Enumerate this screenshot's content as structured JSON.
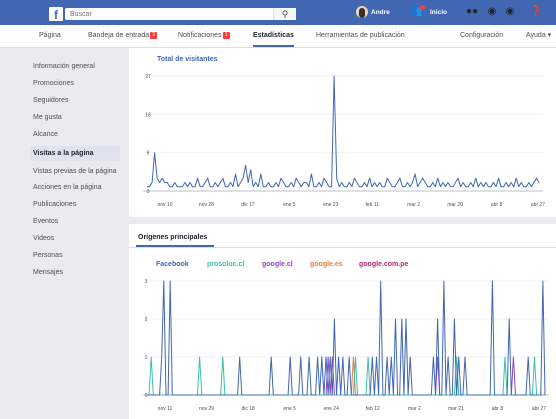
{
  "topbar": {
    "logo": "f",
    "search_placeholder": "Buscar",
    "search_icon": "search-icon",
    "user_name": "Andre",
    "home_label": "Inicio",
    "accent": "#4267b2"
  },
  "tabs": [
    {
      "label": "Página"
    },
    {
      "label": "Bandeja de entrada",
      "badge": "2"
    },
    {
      "label": "Notificaciones",
      "badge": "1"
    },
    {
      "label": "Estadísticas",
      "active": true
    },
    {
      "label": "Herramientas de publicación"
    },
    {
      "label": "Configuración"
    },
    {
      "label": "Ayuda ▾"
    }
  ],
  "sidebar": {
    "items": [
      {
        "label": "Información general"
      },
      {
        "label": "Promociones"
      },
      {
        "label": "Seguidores"
      },
      {
        "label": "Me gusta"
      },
      {
        "label": "Alcance"
      },
      {
        "label": "Visitas a la página",
        "active": true
      },
      {
        "label": "Vistas previas de la página"
      },
      {
        "label": "Acciones en la página"
      },
      {
        "label": "Publicaciones"
      },
      {
        "label": "Eventos"
      },
      {
        "label": "Videos"
      },
      {
        "label": "Personas"
      },
      {
        "label": "Mensajes"
      }
    ]
  },
  "chart_data": [
    {
      "type": "line",
      "title": "Total de visitantes",
      "ylim": [
        0,
        27
      ],
      "yticks": [
        "0",
        "9",
        "18",
        "27"
      ],
      "xticks": [
        "nov 10",
        "nov 28",
        "dic 17",
        "ene 5",
        "ene 23",
        "feb 11",
        "mar 2",
        "mar 20",
        "abr 8",
        "abr 27"
      ],
      "series": [
        {
          "color": "#4267b2",
          "values": [
            1,
            1,
            2,
            9,
            3,
            2,
            3,
            2,
            2,
            1,
            1,
            2,
            1,
            1,
            1,
            2,
            1,
            2,
            1,
            1,
            3,
            1,
            1,
            2,
            3,
            1,
            1,
            2,
            1,
            2,
            3,
            1,
            1,
            2,
            1,
            4,
            1,
            2,
            3,
            6,
            2,
            5,
            1,
            2,
            1,
            4,
            1,
            1,
            2,
            1,
            1,
            2,
            1,
            3,
            2,
            1,
            1,
            2,
            1,
            3,
            2,
            1,
            2,
            2,
            1,
            4,
            1,
            1,
            2,
            1,
            3,
            2,
            1,
            1,
            27,
            3,
            1,
            2,
            1,
            1,
            2,
            1,
            3,
            2,
            1,
            1,
            2,
            1,
            3,
            1,
            2,
            1,
            2,
            1,
            1,
            3,
            2,
            1,
            1,
            2,
            3,
            1,
            1,
            2,
            1,
            2,
            4,
            1,
            2,
            3,
            2,
            1,
            1,
            2,
            1,
            3,
            1,
            2,
            1,
            2,
            1,
            1,
            2,
            3,
            1,
            2,
            1,
            1,
            2,
            1,
            3,
            1,
            2,
            1,
            2,
            1,
            1,
            2,
            1,
            3,
            1,
            1,
            2,
            1,
            2,
            1,
            3,
            1,
            2,
            1,
            1,
            2,
            1,
            2,
            3,
            2
          ]
        }
      ]
    },
    {
      "type": "line",
      "title": "Orígenes principales",
      "ylim": [
        0,
        3
      ],
      "yticks": [
        "0",
        "1",
        "2",
        "3"
      ],
      "xticks": [
        "nov 11",
        "nov 29",
        "dic 18",
        "ene 5",
        "ene 24",
        "feb 12",
        "mar 2",
        "mar 21",
        "abr 8",
        "abr 27"
      ],
      "series": [
        {
          "name": "Facebook",
          "color": "#4267b2",
          "values": [
            0,
            0,
            0,
            0,
            0,
            0,
            0,
            1,
            3,
            0,
            0,
            3,
            0,
            0,
            0,
            0,
            0,
            0,
            0,
            0,
            0,
            0,
            0,
            0,
            0,
            0,
            0,
            0,
            0,
            0,
            0,
            0,
            0,
            0,
            0,
            0,
            0,
            0,
            0,
            0,
            0,
            0,
            0,
            0,
            1,
            0,
            0,
            0,
            0,
            0,
            0,
            0,
            0,
            0,
            0,
            0,
            0,
            0,
            0,
            1,
            0,
            0,
            0,
            0,
            0,
            0,
            0,
            0,
            1,
            0,
            0,
            0,
            0,
            1,
            0,
            0,
            0,
            1,
            0,
            0,
            0,
            1,
            0,
            1,
            0,
            1,
            0,
            1,
            0,
            2,
            0,
            1,
            0,
            1,
            0,
            0,
            1,
            0,
            0,
            0,
            0,
            0,
            0,
            0,
            0,
            0,
            0,
            1,
            0,
            1,
            0,
            3,
            0,
            0,
            1,
            0,
            1,
            0,
            2,
            0,
            0,
            2,
            0,
            2,
            0,
            1,
            0,
            0,
            0,
            0,
            0,
            0,
            0,
            0,
            0,
            0,
            1,
            0,
            2,
            0,
            0,
            3,
            0,
            1,
            0,
            0,
            2,
            0,
            1,
            0,
            0,
            1,
            0,
            0,
            0,
            0,
            0,
            0,
            0,
            0,
            0,
            0,
            0,
            0,
            3,
            0,
            0,
            0,
            0,
            0,
            0,
            0,
            2,
            0,
            0,
            0,
            0,
            0,
            0,
            0,
            0,
            1,
            0,
            0,
            0,
            0,
            0,
            0,
            3,
            0
          ]
        },
        {
          "name": "prosoluc.cl",
          "color": "#3bbfad",
          "values": [
            0,
            0,
            1,
            0,
            0,
            0,
            0,
            0,
            0,
            0,
            0,
            0,
            0,
            0,
            0,
            0,
            0,
            0,
            0,
            0,
            0,
            0,
            0,
            0,
            0,
            1,
            0,
            0,
            0,
            0,
            0,
            0,
            0,
            0,
            0,
            0,
            1,
            0,
            0,
            0,
            0,
            0,
            0,
            0,
            0,
            0,
            0,
            0,
            0,
            0,
            0,
            0,
            0,
            0,
            0,
            0,
            0,
            0,
            0,
            0,
            0,
            0,
            0,
            0,
            0,
            0,
            0,
            0,
            0,
            0,
            0,
            0,
            0,
            0,
            0,
            0,
            0,
            0,
            0,
            0,
            0,
            0,
            0,
            0,
            0,
            0,
            0,
            0,
            0,
            0,
            0,
            0,
            0,
            0,
            0,
            0,
            0,
            0,
            0,
            1,
            0,
            0,
            0,
            0,
            0,
            1,
            0,
            0,
            0,
            0,
            0,
            0,
            0,
            0,
            0,
            0,
            0,
            0,
            0,
            0,
            0,
            0,
            0,
            0,
            0,
            0,
            0,
            0,
            0,
            0,
            0,
            0,
            0,
            0,
            0,
            0,
            0,
            0,
            0,
            0,
            0,
            0,
            0,
            0,
            0,
            0,
            0,
            1,
            0,
            0,
            0,
            0,
            0,
            0,
            0,
            0,
            0,
            0,
            0,
            0,
            0,
            0,
            0,
            0,
            0,
            0,
            0,
            0,
            0,
            0,
            1,
            0,
            0,
            0,
            0,
            0,
            0,
            0,
            0,
            0,
            0,
            0,
            0,
            0,
            1,
            0,
            0,
            0,
            0,
            0
          ]
        },
        {
          "name": "google.cl",
          "color": "#8c45c4",
          "values": [
            0,
            0,
            0,
            0,
            0,
            0,
            0,
            0,
            0,
            0,
            0,
            0,
            0,
            0,
            0,
            0,
            0,
            0,
            0,
            0,
            0,
            0,
            0,
            0,
            0,
            0,
            0,
            0,
            0,
            0,
            0,
            0,
            0,
            0,
            0,
            0,
            0,
            0,
            0,
            0,
            0,
            0,
            0,
            0,
            0,
            0,
            0,
            0,
            0,
            0,
            0,
            0,
            0,
            0,
            0,
            0,
            0,
            0,
            0,
            0,
            0,
            0,
            0,
            0,
            0,
            0,
            0,
            0,
            0,
            0,
            0,
            0,
            0,
            0,
            0,
            0,
            0,
            0,
            0,
            0,
            0,
            0,
            0,
            0,
            0,
            0,
            1,
            0,
            1,
            0,
            0,
            0,
            0,
            0,
            0,
            0,
            0,
            0,
            0,
            0,
            0,
            0,
            0,
            0,
            0,
            0,
            0,
            0,
            0,
            0,
            0,
            0,
            0,
            0,
            0,
            0,
            0,
            0,
            0,
            0,
            0,
            0,
            0,
            0,
            0,
            0,
            0,
            0,
            0,
            0,
            0,
            0,
            0,
            0,
            0,
            0,
            0,
            0,
            1,
            0,
            0,
            0,
            0,
            0,
            0,
            0,
            0,
            0,
            0,
            0,
            0,
            0,
            0,
            0,
            0,
            0,
            0,
            0,
            0,
            0,
            0,
            0,
            0,
            0,
            0,
            0,
            0,
            0,
            0,
            0,
            0,
            0,
            0,
            0,
            1,
            0,
            0,
            0,
            0,
            0,
            0,
            0,
            0,
            0,
            0,
            0,
            0,
            0,
            0,
            0
          ]
        },
        {
          "name": "google.es",
          "color": "#f0783c",
          "values": [
            0,
            0,
            0,
            0,
            0,
            0,
            0,
            0,
            0,
            0,
            0,
            0,
            0,
            0,
            0,
            0,
            0,
            0,
            0,
            0,
            0,
            0,
            0,
            0,
            0,
            0,
            0,
            0,
            0,
            0,
            0,
            0,
            0,
            0,
            0,
            0,
            0,
            0,
            0,
            0,
            0,
            0,
            0,
            0,
            0,
            0,
            0,
            0,
            0,
            0,
            0,
            0,
            0,
            0,
            0,
            0,
            0,
            0,
            0,
            0,
            0,
            0,
            0,
            0,
            0,
            0,
            0,
            0,
            0,
            0,
            0,
            0,
            0,
            0,
            0,
            0,
            0,
            0,
            0,
            0,
            0,
            0,
            0,
            0,
            0,
            0,
            0,
            0,
            0,
            0,
            0,
            0,
            0,
            0,
            0,
            0,
            0,
            0,
            1,
            0,
            0,
            0,
            0,
            0,
            0,
            0,
            0,
            0,
            0,
            0,
            0,
            0,
            0,
            0,
            0,
            0,
            0,
            0,
            0,
            0,
            0,
            0,
            0,
            0,
            0,
            0,
            0,
            0,
            0,
            0,
            0,
            0,
            0,
            0,
            0,
            0,
            0,
            0,
            0,
            0,
            0,
            0,
            0,
            0,
            0,
            0,
            0,
            0,
            0,
            0,
            0,
            0,
            0,
            0,
            0,
            0,
            0,
            0,
            0,
            0,
            0,
            0,
            0,
            0,
            0,
            0,
            0,
            0,
            0,
            0,
            0,
            0,
            0,
            0,
            0,
            0,
            0,
            0,
            0,
            0,
            0,
            0,
            0,
            0,
            0,
            0,
            0,
            0,
            0,
            0
          ]
        },
        {
          "name": "google.com.pe",
          "color": "#b3296b",
          "values": [
            0,
            0,
            0,
            0,
            0,
            0,
            0,
            0,
            0,
            0,
            0,
            0,
            0,
            0,
            0,
            0,
            0,
            0,
            0,
            0,
            0,
            0,
            0,
            0,
            0,
            0,
            0,
            0,
            0,
            0,
            0,
            0,
            0,
            0,
            0,
            0,
            0,
            0,
            0,
            0,
            0,
            0,
            0,
            0,
            0,
            0,
            0,
            0,
            0,
            0,
            0,
            0,
            0,
            0,
            0,
            0,
            0,
            0,
            0,
            0,
            0,
            0,
            0,
            0,
            0,
            0,
            0,
            0,
            0,
            0,
            0,
            0,
            0,
            0,
            0,
            0,
            0,
            0,
            0,
            0,
            0,
            0,
            0,
            0,
            0,
            0,
            0,
            0,
            0,
            0,
            0,
            0,
            0,
            0,
            0,
            0,
            0,
            0,
            0,
            0,
            0,
            0,
            0,
            0,
            0,
            0,
            0,
            0,
            0,
            0,
            0,
            0,
            0,
            0,
            0,
            0,
            0,
            0,
            0,
            0,
            0,
            0,
            0,
            0,
            0,
            0,
            0,
            0,
            0,
            0,
            0,
            0,
            0,
            0,
            0,
            0,
            0,
            0,
            0,
            0,
            0,
            0,
            0,
            0,
            0,
            0,
            0,
            0,
            0,
            0,
            0,
            0,
            0,
            0,
            0,
            0,
            0,
            0,
            0,
            0,
            0,
            0,
            0,
            0,
            0,
            0,
            0,
            0,
            0,
            0,
            0,
            0,
            0,
            0,
            0,
            0,
            0,
            0,
            0,
            0,
            0,
            0,
            0,
            0,
            0,
            0,
            0,
            0,
            0,
            0
          ]
        }
      ]
    }
  ]
}
